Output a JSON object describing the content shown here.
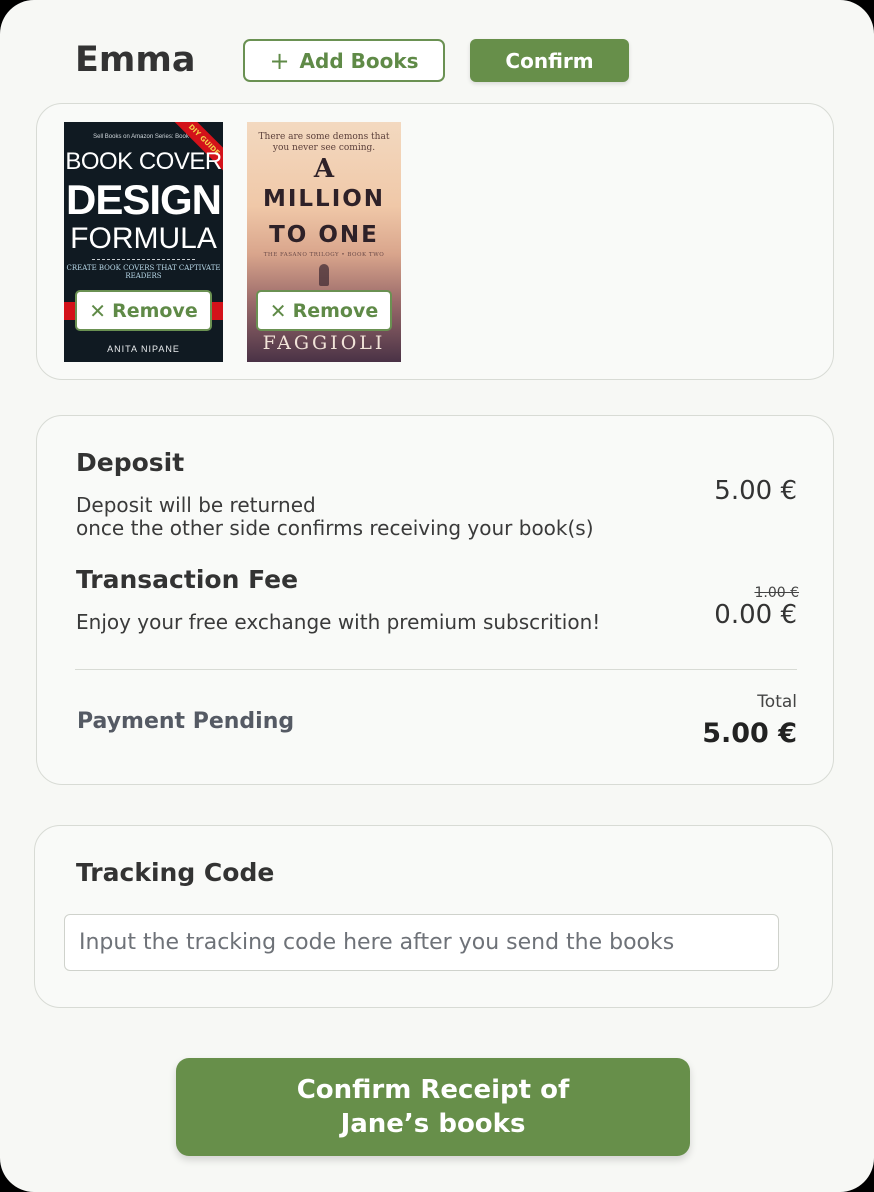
{
  "header": {
    "user_name": "Emma",
    "add_books_label": "Add Books",
    "confirm_label": "Confirm"
  },
  "books": [
    {
      "series_text": "Sell Books on Amazon Series: Book 1",
      "ribbon_text": "DIY GUIDE",
      "title_line1": "BOOK COVER",
      "title_line2": "DESIGN",
      "title_line3": "FORMULA",
      "subtitle": "CREATE BOOK COVERS THAT CAPTIVATE READERS",
      "author": "ANITA NIPANE",
      "remove_label": "Remove"
    },
    {
      "tagline": "There are some demons that you never see coming.",
      "title_a": "A",
      "title_line1": "MILLION",
      "title_line2": "TO ONE",
      "subtitle": "THE FASANO TRILOGY • BOOK TWO",
      "author": "FAGGIOLI",
      "remove_label": "Remove"
    }
  ],
  "payment": {
    "deposit_title": "Deposit",
    "deposit_desc_line1": "Deposit will be returned",
    "deposit_desc_line2": "once the other side confirms receiving your book(s)",
    "deposit_amount": "5.00 €",
    "fee_title": "Transaction Fee",
    "fee_desc": "Enjoy your free exchange with premium subscrition!",
    "fee_original": "1.00 €",
    "fee_amount": "0.00 €",
    "status": "Payment Pending",
    "total_label": "Total",
    "total_amount": "5.00 €"
  },
  "tracking": {
    "title": "Tracking Code",
    "placeholder": "Input the tracking code here after you send the books"
  },
  "footer": {
    "confirm_receipt_label": "Confirm Receipt of\nJane’s books"
  },
  "colors": {
    "accent_green": "#678f4a",
    "background": "#f7f8f5"
  }
}
